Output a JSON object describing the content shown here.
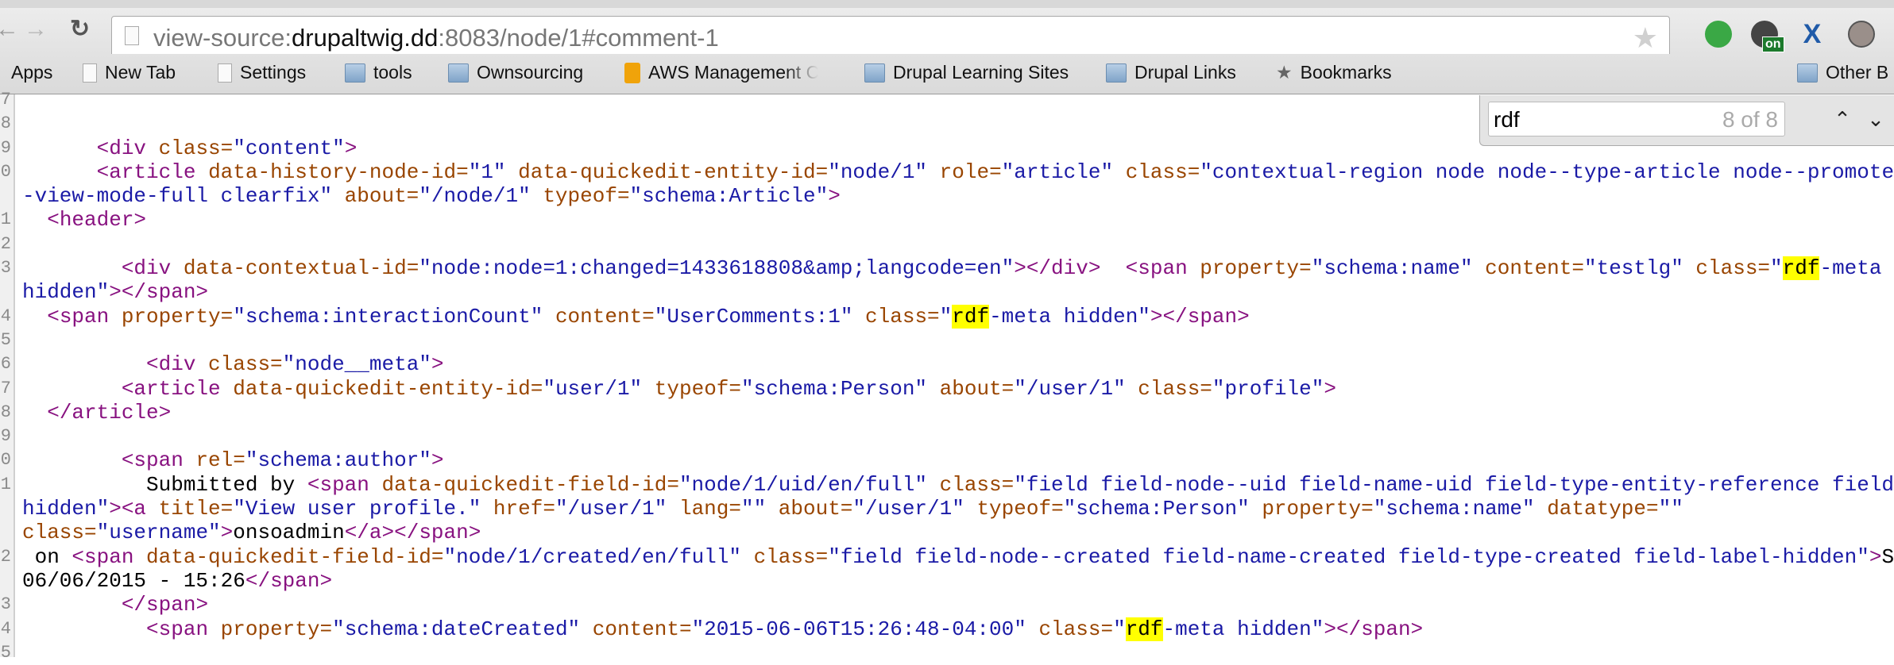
{
  "browser": {
    "url_scheme": "view-source:",
    "url_host": "drupaltwig.dd",
    "url_rest": ":8083/node/1#comment-1",
    "extensions": [
      {
        "name": "hangouts-icon",
        "color": "#3aa845"
      },
      {
        "name": "timer-on-icon",
        "color": "#444444",
        "badge": "on"
      },
      {
        "name": "jira-icon",
        "color": "#1f5aa8"
      },
      {
        "name": "w-extension-icon",
        "color": "#9a8f8a"
      }
    ]
  },
  "bookmarks": [
    {
      "label": "Apps",
      "icon": "apps"
    },
    {
      "label": "New Tab",
      "icon": "page"
    },
    {
      "label": "Settings",
      "icon": "page"
    },
    {
      "label": "tools",
      "icon": "folder"
    },
    {
      "label": "Ownsourcing",
      "icon": "folder"
    },
    {
      "label": "AWS Management Co",
      "icon": "aws"
    },
    {
      "label": "Drupal Learning Sites",
      "icon": "folder"
    },
    {
      "label": "Drupal Links",
      "icon": "folder"
    },
    {
      "label": "Bookmarks",
      "icon": "star"
    }
  ],
  "other_bookmarks": "Other B",
  "find": {
    "query": "rdf",
    "count": "8 of 8",
    "prev": "^",
    "next": "v"
  },
  "colors": {
    "tag": "#881280",
    "attr": "#994500",
    "value": "#1a1aa6",
    "highlight": "#ffff00"
  },
  "source_rows": [
    {
      "n": "7",
      "tok": []
    },
    {
      "n": "8",
      "tok": []
    },
    {
      "n": "9",
      "tok": [
        [
          "x",
          "      "
        ],
        [
          "t",
          "<div "
        ],
        [
          "a",
          "class="
        ],
        [
          "v",
          "\"content\""
        ],
        [
          "t",
          ">"
        ]
      ]
    },
    {
      "n": "0",
      "tok": [
        [
          "x",
          "      "
        ],
        [
          "t",
          "<article "
        ],
        [
          "a",
          "data-history-node-id="
        ],
        [
          "v",
          "\"1\" "
        ],
        [
          "a",
          "data-quickedit-entity-id="
        ],
        [
          "v",
          "\"node/1\" "
        ],
        [
          "a",
          "role="
        ],
        [
          "v",
          "\"article\" "
        ],
        [
          "a",
          "class="
        ],
        [
          "v",
          "\"contextual-region node node--type-article node--promoted"
        ]
      ]
    },
    {
      "n": "",
      "tok": [
        [
          "v",
          "-view-mode-full clearfix\" "
        ],
        [
          "a",
          "about="
        ],
        [
          "v",
          "\"/node/1\" "
        ],
        [
          "a",
          "typeof="
        ],
        [
          "v",
          "\"schema:Article\""
        ],
        [
          "t",
          ">"
        ]
      ]
    },
    {
      "n": "1",
      "tok": [
        [
          "x",
          "  "
        ],
        [
          "t",
          "<header>"
        ]
      ]
    },
    {
      "n": "2",
      "tok": []
    },
    {
      "n": "3",
      "tok": [
        [
          "x",
          "        "
        ],
        [
          "t",
          "<div "
        ],
        [
          "a",
          "data-contextual-id="
        ],
        [
          "v",
          "\"node:node=1:changed=1433618808&amp;langcode=en\""
        ],
        [
          "t",
          "></div>"
        ],
        [
          "x",
          "  "
        ],
        [
          "t",
          "<span "
        ],
        [
          "a",
          "property="
        ],
        [
          "v",
          "\"schema:name\" "
        ],
        [
          "a",
          "content="
        ],
        [
          "v",
          "\"testlg\" "
        ],
        [
          "a",
          "class="
        ],
        [
          "v",
          "\""
        ],
        [
          "h",
          "rdf"
        ],
        [
          "v",
          "-meta"
        ]
      ]
    },
    {
      "n": "",
      "tok": [
        [
          "v",
          "hidden\""
        ],
        [
          "t",
          "></span>"
        ]
      ]
    },
    {
      "n": "4",
      "tok": [
        [
          "x",
          "  "
        ],
        [
          "t",
          "<span "
        ],
        [
          "a",
          "property="
        ],
        [
          "v",
          "\"schema:interactionCount\" "
        ],
        [
          "a",
          "content="
        ],
        [
          "v",
          "\"UserComments:1\" "
        ],
        [
          "a",
          "class="
        ],
        [
          "v",
          "\""
        ],
        [
          "h",
          "rdf"
        ],
        [
          "v",
          "-meta hidden\""
        ],
        [
          "t",
          "></span>"
        ]
      ]
    },
    {
      "n": "5",
      "tok": []
    },
    {
      "n": "6",
      "tok": [
        [
          "x",
          "          "
        ],
        [
          "t",
          "<div "
        ],
        [
          "a",
          "class="
        ],
        [
          "v",
          "\"node__meta\""
        ],
        [
          "t",
          ">"
        ]
      ]
    },
    {
      "n": "7",
      "tok": [
        [
          "x",
          "        "
        ],
        [
          "t",
          "<article "
        ],
        [
          "a",
          "data-quickedit-entity-id="
        ],
        [
          "v",
          "\"user/1\" "
        ],
        [
          "a",
          "typeof="
        ],
        [
          "v",
          "\"schema:Person\" "
        ],
        [
          "a",
          "about="
        ],
        [
          "v",
          "\"/user/1\" "
        ],
        [
          "a",
          "class="
        ],
        [
          "v",
          "\"profile\""
        ],
        [
          "t",
          ">"
        ]
      ]
    },
    {
      "n": "8",
      "tok": [
        [
          "x",
          "  "
        ],
        [
          "t",
          "</article>"
        ]
      ]
    },
    {
      "n": "9",
      "tok": []
    },
    {
      "n": "0",
      "tok": [
        [
          "x",
          "        "
        ],
        [
          "t",
          "<span "
        ],
        [
          "a",
          "rel="
        ],
        [
          "v",
          "\"schema:author\""
        ],
        [
          "t",
          ">"
        ]
      ]
    },
    {
      "n": "1",
      "tok": [
        [
          "x",
          "          Submitted by "
        ],
        [
          "t",
          "<span "
        ],
        [
          "a",
          "data-quickedit-field-id="
        ],
        [
          "v",
          "\"node/1/uid/en/full\" "
        ],
        [
          "a",
          "class="
        ],
        [
          "v",
          "\"field field-node--uid field-name-uid field-type-entity-reference field-label"
        ]
      ]
    },
    {
      "n": "",
      "tok": [
        [
          "v",
          "hidden\""
        ],
        [
          "t",
          "><a "
        ],
        [
          "a",
          "title="
        ],
        [
          "v",
          "\"View user profile.\" "
        ],
        [
          "a",
          "href="
        ],
        [
          "v",
          "\"/user/1\" "
        ],
        [
          "a",
          "lang="
        ],
        [
          "v",
          "\"\" "
        ],
        [
          "a",
          "about="
        ],
        [
          "v",
          "\"/user/1\" "
        ],
        [
          "a",
          "typeof="
        ],
        [
          "v",
          "\"schema:Person\" "
        ],
        [
          "a",
          "property="
        ],
        [
          "v",
          "\"schema:name\" "
        ],
        [
          "a",
          "datatype="
        ],
        [
          "v",
          "\"\""
        ]
      ]
    },
    {
      "n": "",
      "tok": [
        [
          "a",
          "class="
        ],
        [
          "v",
          "\"username\""
        ],
        [
          "t",
          ">"
        ],
        [
          "x",
          "onsoadmin"
        ],
        [
          "t",
          "</a></span>"
        ]
      ]
    },
    {
      "n": "2",
      "tok": [
        [
          "x",
          " on "
        ],
        [
          "t",
          "<span "
        ],
        [
          "a",
          "data-quickedit-field-id="
        ],
        [
          "v",
          "\"node/1/created/en/full\" "
        ],
        [
          "a",
          "class="
        ],
        [
          "v",
          "\"field field-node--created field-name-created field-type-created field-label-hidden\""
        ],
        [
          "t",
          ">"
        ],
        [
          "x",
          "S"
        ]
      ]
    },
    {
      "n": "",
      "tok": [
        [
          "x",
          "06/06/2015 - 15:26"
        ],
        [
          "t",
          "</span>"
        ]
      ]
    },
    {
      "n": "3",
      "tok": [
        [
          "x",
          "        "
        ],
        [
          "t",
          "</span>"
        ]
      ]
    },
    {
      "n": "4",
      "tok": [
        [
          "x",
          "          "
        ],
        [
          "t",
          "<span "
        ],
        [
          "a",
          "property="
        ],
        [
          "v",
          "\"schema:dateCreated\" "
        ],
        [
          "a",
          "content="
        ],
        [
          "v",
          "\"2015-06-06T15:26:48-04:00\" "
        ],
        [
          "a",
          "class="
        ],
        [
          "v",
          "\""
        ],
        [
          "h",
          "rdf"
        ],
        [
          "v",
          "-meta hidden\""
        ],
        [
          "t",
          "></span>"
        ]
      ]
    },
    {
      "n": "5",
      "tok": []
    }
  ]
}
